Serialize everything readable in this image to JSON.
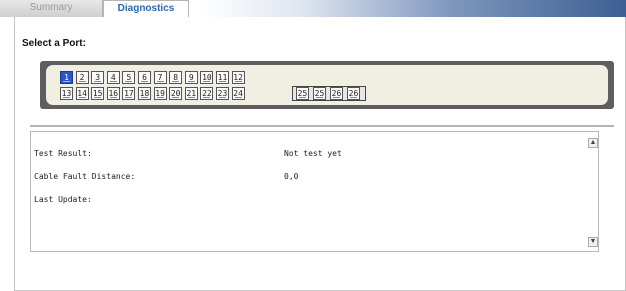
{
  "tabs": [
    {
      "label": "Summary",
      "active": false
    },
    {
      "label": "Diagnostics",
      "active": true
    }
  ],
  "port_selector": {
    "title": "Select a Port:",
    "selected_port": "1",
    "row1": [
      "1",
      "2",
      "3",
      "4",
      "5",
      "6",
      "7",
      "8",
      "9",
      "10",
      "11",
      "12"
    ],
    "row2": [
      "13",
      "14",
      "15",
      "16",
      "17",
      "18",
      "19",
      "20",
      "21",
      "22",
      "23",
      "24"
    ],
    "sfp": [
      "25",
      "25",
      "26",
      "26"
    ]
  },
  "results": {
    "test_result_label": "Test Result:",
    "test_result_value": "Not test yet",
    "cable_fault_label": "Cable Fault Distance:",
    "cable_fault_value": "0,0",
    "last_update_label": "Last Update:"
  },
  "colors": {
    "selected_port": "#2c54c8",
    "tab_active_text": "#2f66a8"
  },
  "icons": {
    "scroll_up": "scroll-up-icon",
    "scroll_down": "scroll-down-icon"
  }
}
